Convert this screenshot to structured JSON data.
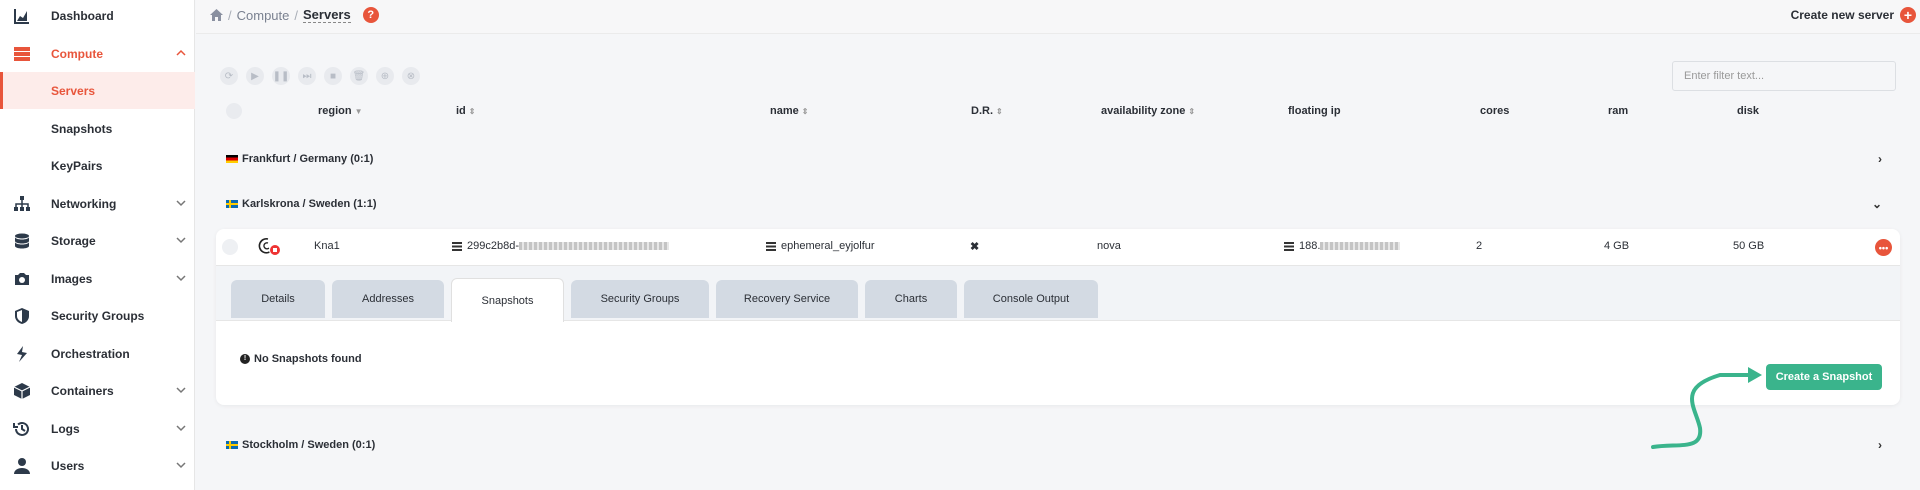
{
  "sidebar": {
    "items": [
      {
        "label": "Dashboard",
        "icon": "chart-icon"
      },
      {
        "label": "Compute",
        "icon": "server-icon"
      },
      {
        "label": "Networking",
        "icon": "network-icon"
      },
      {
        "label": "Storage",
        "icon": "database-icon"
      },
      {
        "label": "Images",
        "icon": "camera-icon"
      },
      {
        "label": "Security Groups",
        "icon": "shield-icon"
      },
      {
        "label": "Orchestration",
        "icon": "orchestration-icon"
      },
      {
        "label": "Containers",
        "icon": "box-icon"
      },
      {
        "label": "Logs",
        "icon": "history-icon"
      },
      {
        "label": "Users",
        "icon": "user-icon"
      }
    ],
    "compute_sub": [
      {
        "label": "Servers",
        "selected": true
      },
      {
        "label": "Snapshots"
      },
      {
        "label": "KeyPairs"
      }
    ]
  },
  "topbar": {
    "breadcrumb": [
      "Compute",
      "Servers"
    ],
    "sep": "/",
    "help": "?",
    "create_label": "Create new server",
    "create_plus": "+"
  },
  "filter": {
    "placeholder": "Enter filter text..."
  },
  "table": {
    "headers": [
      "region",
      "id",
      "name",
      "D.R.",
      "availability zone",
      "floating ip",
      "cores",
      "ram",
      "disk"
    ],
    "sort_icons": {
      "desc": "▼",
      "both": "⇕"
    }
  },
  "groups": [
    {
      "label": "Frankfurt / Germany (0:1)",
      "flag": "de",
      "expander": "›"
    },
    {
      "label": "Karlskrona / Sweden (1:1)",
      "flag": "se",
      "expander": "⌄"
    },
    {
      "label": "Stockholm / Sweden (0:1)",
      "flag": "se",
      "expander": "›"
    }
  ],
  "server": {
    "region": "Kna1",
    "id_prefix": "299c2b8d-",
    "name": "ephemeral_eyjolfur",
    "dr": "✖",
    "zone": "nova",
    "ip_prefix": "188.",
    "cores": "2",
    "ram": "4 GB",
    "disk": "50 GB",
    "more": "•••"
  },
  "tabs": [
    "Details",
    "Addresses",
    "Snapshots",
    "Security Groups",
    "Recovery Service",
    "Charts",
    "Console Output"
  ],
  "active_tab": "Snapshots",
  "snapshots": {
    "empty_text": "No Snapshots found",
    "info": "!",
    "create_label": "Create a Snapshot"
  },
  "colors": {
    "accent": "#e8553b",
    "green": "#3ab48c"
  }
}
